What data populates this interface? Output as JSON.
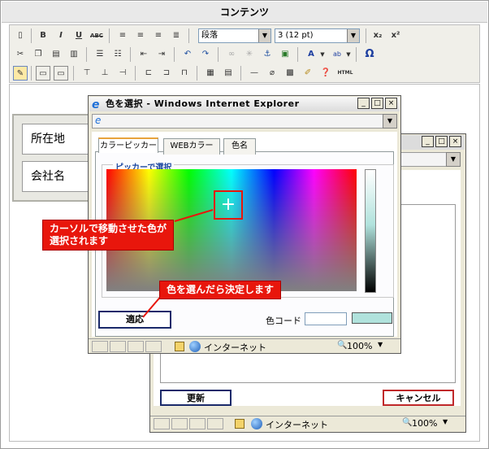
{
  "page": {
    "title": "コンテンツ"
  },
  "toolbar": {
    "row1": {
      "bold": "B",
      "italic": "I",
      "underline": "U",
      "strike": "ABC",
      "format_select": "段落",
      "size_select": "3 (12 pt)",
      "subscript": "x₂",
      "superscript": "x²"
    },
    "row2": {
      "omega": "Ω"
    },
    "row3": {
      "html": "HTML"
    }
  },
  "fields": {
    "address": "所在地",
    "company": "会社名"
  },
  "back_window": {
    "update_button": "更新",
    "cancel_button": "キャンセル",
    "status": {
      "zone": "インターネット",
      "zoom": "100%"
    }
  },
  "picker_window": {
    "title": "色を選択 - Windows Internet Explorer",
    "tabs": [
      "カラーピッカー",
      "WEBカラー",
      "色名"
    ],
    "group_label": "ピッカーで選択",
    "apply_button": "適応",
    "color_code_label": "色コード",
    "color_code_value": "",
    "selected_color": "#b0e2dc",
    "status": {
      "zone": "インターネット",
      "zoom": "100%"
    }
  },
  "annotations": {
    "cursor_note": "カーソルで移動させた色が\n選択されます",
    "decide_note": "色を選んだら決定します"
  },
  "colors": {
    "accent": "#e8160c",
    "button_border": "#1a2a6a",
    "cancel_border": "#c0282a"
  }
}
